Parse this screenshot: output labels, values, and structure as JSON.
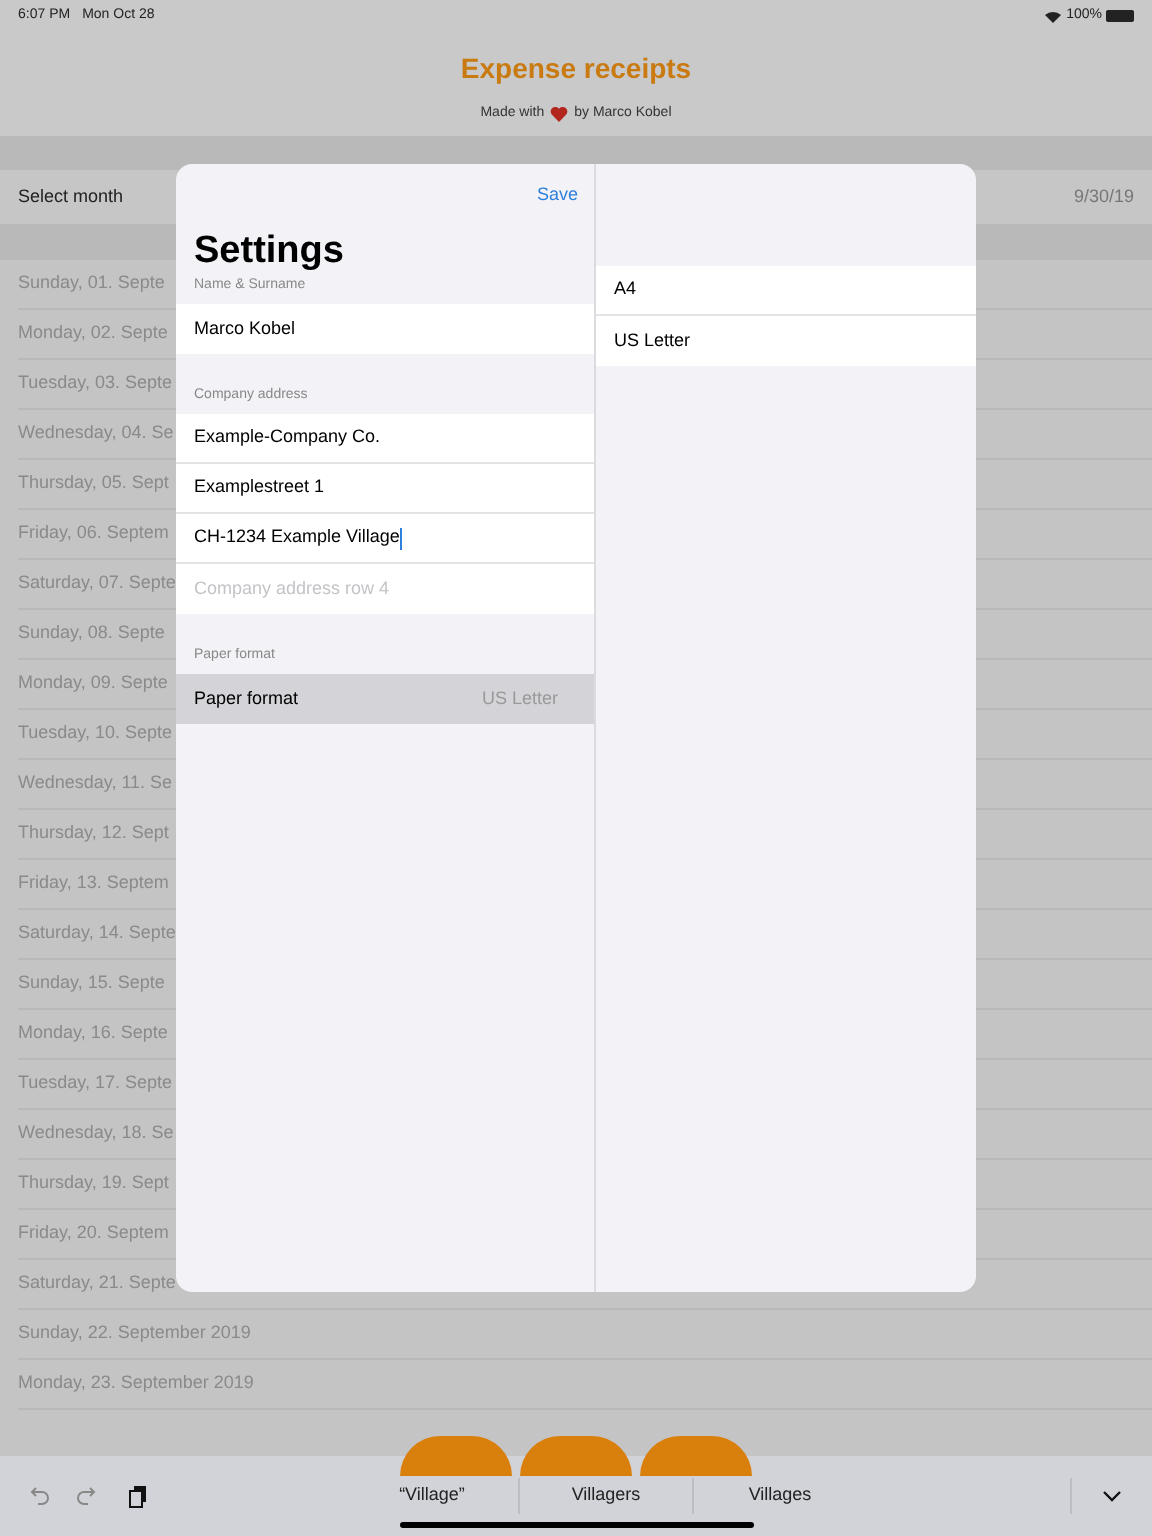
{
  "status_bar": {
    "time": "6:07 PM",
    "date": "Mon Oct 28",
    "battery": "100%"
  },
  "header": {
    "title": "Expense receipts",
    "subtitle_before": "Made with",
    "subtitle_after": "by Marco Kobel"
  },
  "month_row": {
    "label": "Select month",
    "value": "9/30/19"
  },
  "days": [
    "Sunday, 01. Septe",
    "Monday, 02. Septe",
    "Tuesday, 03. Septe",
    "Wednesday, 04. Se",
    "Thursday, 05. Sept",
    "Friday, 06. Septem",
    "Saturday, 07. Septe",
    "Sunday, 08. Septe",
    "Monday, 09. Septe",
    "Tuesday, 10. Septe",
    "Wednesday, 11. Se",
    "Thursday, 12. Sept",
    "Friday, 13. Septem",
    "Saturday, 14. Septe",
    "Sunday, 15. Septe",
    "Monday, 16. Septe",
    "Tuesday, 17. Septe",
    "Wednesday, 18. Se",
    "Thursday, 19. Sept",
    "Friday, 20. Septem",
    "Saturday, 21. Septe",
    "Sunday, 22. September 2019",
    "Monday, 23. September 2019"
  ],
  "settings": {
    "save": "Save",
    "title": "Settings",
    "sections": [
      {
        "header": "Name & Surname",
        "rows": [
          {
            "kind": "text",
            "value": "Marco Kobel",
            "focused": false
          }
        ]
      },
      {
        "header": "Company address",
        "rows": [
          {
            "kind": "text",
            "value": "Example-Company Co.",
            "focused": false
          },
          {
            "kind": "text",
            "value": "Examplestreet 1",
            "focused": false
          },
          {
            "kind": "text",
            "value": "CH-1234 Example Village",
            "focused": true
          },
          {
            "kind": "text",
            "placeholder": "Company address row 4",
            "focused": false
          }
        ]
      },
      {
        "header": "Paper format",
        "rows": [
          {
            "kind": "select",
            "label": "Paper format",
            "value": "US Letter",
            "selected": true
          }
        ]
      }
    ],
    "options": [
      {
        "label": "A4"
      },
      {
        "label": "US Letter"
      }
    ]
  },
  "keyboard_bar": {
    "suggestions": [
      "“Village”",
      "Villagers",
      "Villages"
    ]
  }
}
